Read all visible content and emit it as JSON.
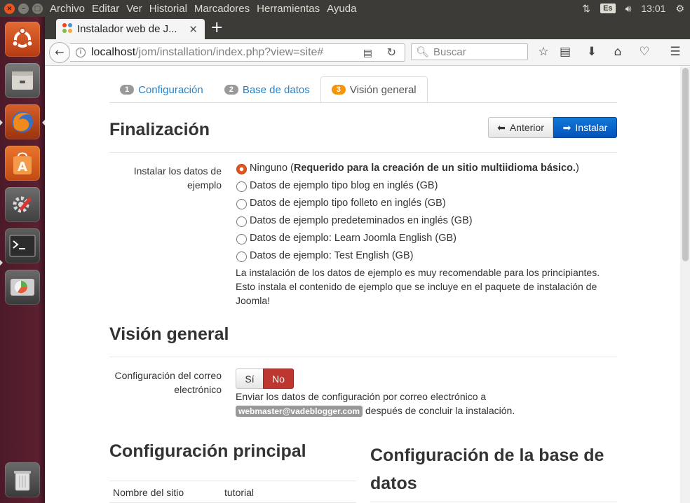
{
  "system_bar": {
    "menus": [
      "Archivo",
      "Editar",
      "Ver",
      "Historial",
      "Marcadores",
      "Herramientas",
      "Ayuda"
    ],
    "keyboard_layout": "Es",
    "time": "13:01"
  },
  "launcher": {
    "items": [
      "ubuntu-dash-icon",
      "files-icon",
      "firefox-icon",
      "software-center-icon",
      "system-settings-icon",
      "terminal-icon",
      "disks-icon",
      "trash-icon"
    ]
  },
  "browser": {
    "tab_title": "Instalador web de J...",
    "new_tab_label": "+",
    "url_host": "localhost",
    "url_path": "/jom/installation/index.php?view=site#",
    "search_placeholder": "Buscar"
  },
  "installer": {
    "steps": [
      {
        "num": "1",
        "label": "Configuración"
      },
      {
        "num": "2",
        "label": "Base de datos"
      },
      {
        "num": "3",
        "label": "Visión general"
      }
    ],
    "active_step": 3,
    "finalization": {
      "title": "Finalización",
      "prev_button": "Anterior",
      "install_button": "Instalar",
      "sample_label": "Instalar los datos de ejemplo",
      "sample_options": [
        {
          "prefix": "Ninguno (",
          "bold": "Requerido para la creación de un sitio multiidioma básico.",
          "suffix": ")"
        },
        {
          "prefix": "Datos de ejemplo tipo blog en inglés (GB)",
          "bold": "",
          "suffix": ""
        },
        {
          "prefix": "Datos de ejemplo tipo folleto en inglés (GB)",
          "bold": "",
          "suffix": ""
        },
        {
          "prefix": "Datos de ejemplo predeteminados en inglés (GB)",
          "bold": "",
          "suffix": ""
        },
        {
          "prefix": "Datos de ejemplo: Learn Joomla English (GB)",
          "bold": "",
          "suffix": ""
        },
        {
          "prefix": "Datos de ejemplo: Test English (GB)",
          "bold": "",
          "suffix": ""
        }
      ],
      "selected_option": 0,
      "sample_help": "La instalación de los datos de ejemplo es muy recomendable para los principiantes. Esto instala el contenido de ejemplo que se incluye en el paquete de instalación de Joomla!"
    },
    "overview": {
      "title": "Visión general",
      "email_label": "Configuración del correo electrónico",
      "yes": "Sí",
      "no": "No",
      "email_help_before": "Enviar los datos de configuración por correo electrónico a",
      "email_address": "webmaster@vadeblogger.com",
      "email_help_after": "después de concluir la instalación."
    },
    "main_config": {
      "title": "Configuración principal",
      "site_name_label": "Nombre del sitio",
      "site_name_value": "tutorial"
    },
    "db_config": {
      "title": "Configuración de la base de datos"
    }
  }
}
